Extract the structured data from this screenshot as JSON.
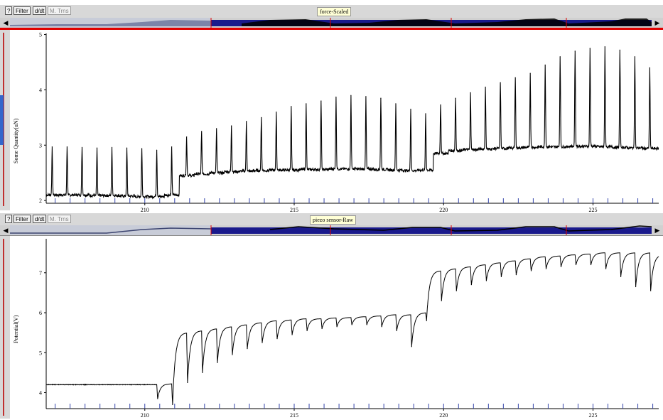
{
  "toolbar_buttons": {
    "help": "?",
    "filter": "Filter",
    "derivative": "d/dt",
    "mean_trend": "M. Trns"
  },
  "colors": {
    "accent_red": "#e00000",
    "overview_blue": "#1a1a8c",
    "toolbar_bg": "#d8d8d8",
    "trace": "#000000"
  },
  "top": {
    "title": "force-Scaled",
    "ylabel": "Some Quantity(uN)"
  },
  "bottom": {
    "title": "piezo sensor-Raw",
    "ylabel": "Potential(V)"
  },
  "chart_data": [
    {
      "type": "line",
      "title": "force-Scaled",
      "xlabel": "",
      "ylabel": "Some Quantity(uN)",
      "xlim": [
        206.7,
        227.2
      ],
      "ylim": [
        1.95,
        5.02
      ],
      "x_ticks": [
        210,
        215,
        220,
        225
      ],
      "y_ticks": [
        2,
        3,
        4,
        5
      ],
      "grid": false,
      "series": [
        {
          "description_of_pulses": "periodic spikes, period ~0.5 s",
          "pulse_times": [
            206.9,
            207.4,
            207.9,
            208.4,
            208.9,
            209.4,
            209.9,
            210.4,
            210.9,
            211.4,
            211.9,
            212.4,
            212.9,
            213.4,
            213.9,
            214.4,
            214.9,
            215.4,
            215.9,
            216.4,
            216.9,
            217.4,
            217.9,
            218.4,
            218.9,
            219.4,
            219.9,
            220.4,
            220.9,
            221.4,
            221.9,
            222.4,
            222.9,
            223.4,
            223.9,
            224.4,
            224.9,
            225.4,
            225.9,
            226.4,
            226.9
          ],
          "peak_values": [
            2.97,
            2.97,
            2.96,
            2.95,
            2.96,
            2.95,
            2.94,
            2.91,
            2.97,
            3.15,
            3.25,
            3.3,
            3.35,
            3.43,
            3.5,
            3.6,
            3.7,
            3.75,
            3.8,
            3.87,
            3.9,
            3.88,
            3.85,
            3.75,
            3.65,
            3.57,
            3.73,
            3.85,
            3.95,
            4.05,
            4.13,
            4.22,
            4.3,
            4.45,
            4.6,
            4.7,
            4.75,
            4.78,
            4.72,
            4.6,
            4.4
          ],
          "baseline_values": [
            2.1,
            2.1,
            2.1,
            2.09,
            2.09,
            2.08,
            2.07,
            2.07,
            2.1,
            2.45,
            2.48,
            2.5,
            2.52,
            2.53,
            2.54,
            2.55,
            2.55,
            2.56,
            2.56,
            2.57,
            2.57,
            2.57,
            2.56,
            2.55,
            2.54,
            2.55,
            2.85,
            2.9,
            2.92,
            2.93,
            2.94,
            2.95,
            2.96,
            2.97,
            2.97,
            2.98,
            2.98,
            2.97,
            2.96,
            2.95,
            2.94
          ]
        }
      ]
    },
    {
      "type": "line",
      "title": "piezo sensor-Raw",
      "xlabel": "",
      "ylabel": "Potential(V)",
      "xlim": [
        206.7,
        227.2
      ],
      "ylim": [
        3.6,
        7.85
      ],
      "x_ticks": [
        210,
        215,
        220,
        225
      ],
      "y_ticks": [
        4,
        5,
        6,
        7
      ],
      "grid": false,
      "series": [
        {
          "description_of_pulses": "periodic downward dips synchronized with force spikes",
          "pulse_times": [
            210.4,
            210.9,
            211.4,
            211.9,
            212.4,
            212.9,
            213.4,
            213.9,
            214.4,
            214.9,
            215.4,
            215.9,
            216.4,
            216.9,
            217.4,
            217.9,
            218.4,
            218.9,
            219.4,
            219.9,
            220.4,
            220.9,
            221.4,
            221.9,
            222.4,
            222.9,
            223.4,
            223.9,
            224.4,
            224.9,
            225.4,
            225.9,
            226.4,
            226.9
          ],
          "plateau_values": [
            4.22,
            5.5,
            5.55,
            5.6,
            5.65,
            5.7,
            5.75,
            5.8,
            5.82,
            5.85,
            5.85,
            5.87,
            5.88,
            5.9,
            5.92,
            5.95,
            5.95,
            6.0,
            7.05,
            7.1,
            7.15,
            7.2,
            7.25,
            7.3,
            7.35,
            7.4,
            7.42,
            7.45,
            7.47,
            7.5,
            7.5,
            7.5,
            7.5,
            7.45
          ],
          "trough_values": [
            3.85,
            3.7,
            4.25,
            4.5,
            4.75,
            4.95,
            5.1,
            5.25,
            5.35,
            5.45,
            5.55,
            5.6,
            5.65,
            5.7,
            5.7,
            5.65,
            5.55,
            5.15,
            5.8,
            6.3,
            6.55,
            6.7,
            6.8,
            6.9,
            6.95,
            7.05,
            7.1,
            7.15,
            7.2,
            7.2,
            7.1,
            6.9,
            6.65,
            6.55
          ],
          "initial_level": 4.2
        }
      ]
    }
  ]
}
